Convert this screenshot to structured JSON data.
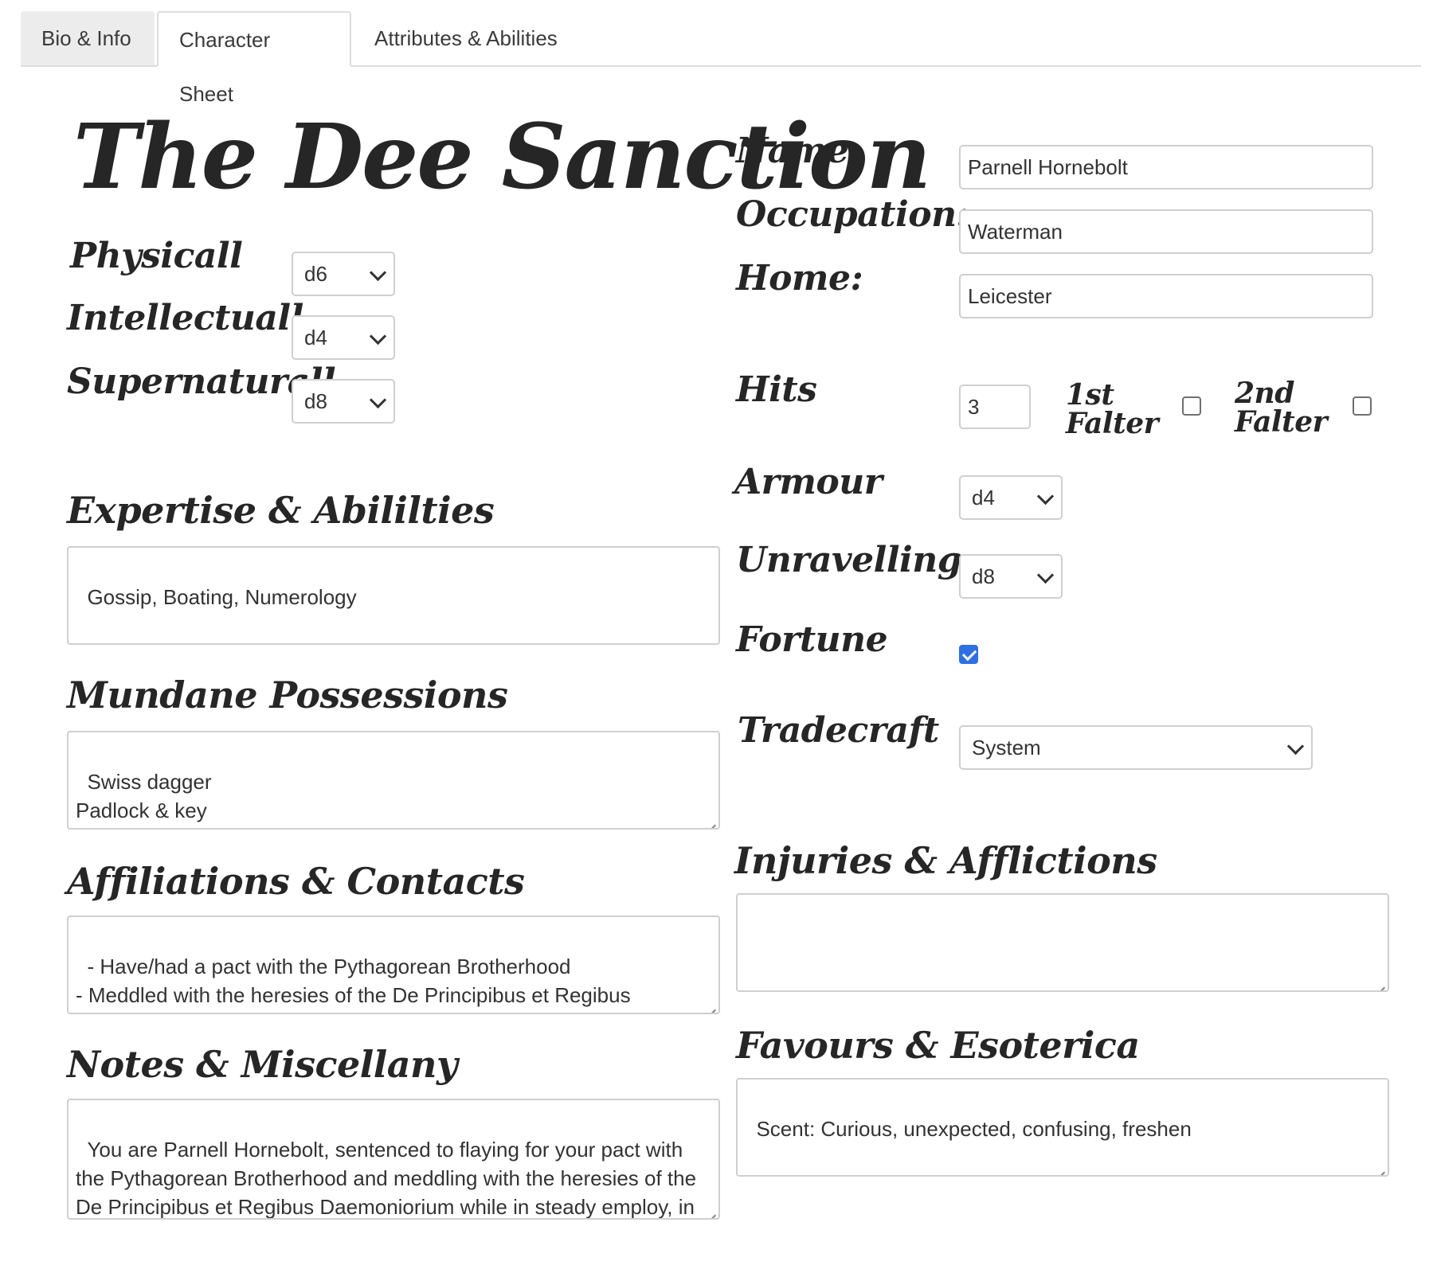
{
  "tabs": [
    {
      "label": "Bio & Info"
    },
    {
      "label": "Character Sheet"
    },
    {
      "label": "Attributes & Abilities"
    }
  ],
  "title": "The Dee Sanction",
  "attributes": {
    "physical": {
      "label": "Physicall",
      "value": "d6"
    },
    "intellectual": {
      "label": "Intellectuall",
      "value": "d4"
    },
    "supernatural": {
      "label": "Supernaturall",
      "value": "d8"
    }
  },
  "identity": {
    "name": {
      "label": "Name:",
      "value": "Parnell Hornebolt"
    },
    "occupation": {
      "label": "Occupation:",
      "value": "Waterman"
    },
    "home": {
      "label": "Home:",
      "value": "Leicester"
    }
  },
  "hits": {
    "label": "Hits",
    "value": "3"
  },
  "falter1": {
    "label_line1": "1st",
    "label_line2": "Falter",
    "checked": false
  },
  "falter2": {
    "label_line1": "2nd",
    "label_line2": "Falter",
    "checked": false
  },
  "armour": {
    "label": "Armour",
    "value": "d4"
  },
  "unravelling": {
    "label": "Unravelling",
    "value": "d8"
  },
  "fortune": {
    "label": "Fortune",
    "checked": true
  },
  "tradecraft": {
    "label": "Tradecraft",
    "value": "System"
  },
  "expertise": {
    "label": "Expertise & Abililties",
    "value": "Gossip, Boating, Numerology"
  },
  "possessions": {
    "label": "Mundane Possessions",
    "value": "Swiss dagger\nPadlock & key\nWool coat"
  },
  "affiliations": {
    "label": "Affiliations & Contacts",
    "value": "- Have/had a pact with the Pythagorean Brotherhood\n- Meddled with the heresies of the De Principibus et Regibus Daemoniorium"
  },
  "notes": {
    "label": "Notes & Miscellany",
    "value": "You are Parnell Hornebolt, sentenced to flaying for your pact with the Pythagorean Brotherhood and meddling with the heresies of the De Principibus et Regibus Daemoniorium while in steady employ, in Leicester, as a Waterman."
  },
  "injuries": {
    "label": "Injuries & Afflictions",
    "value": ""
  },
  "favours": {
    "label": "Favours & Esoterica",
    "value": "Scent: Curious, unexpected, confusing, freshen"
  }
}
